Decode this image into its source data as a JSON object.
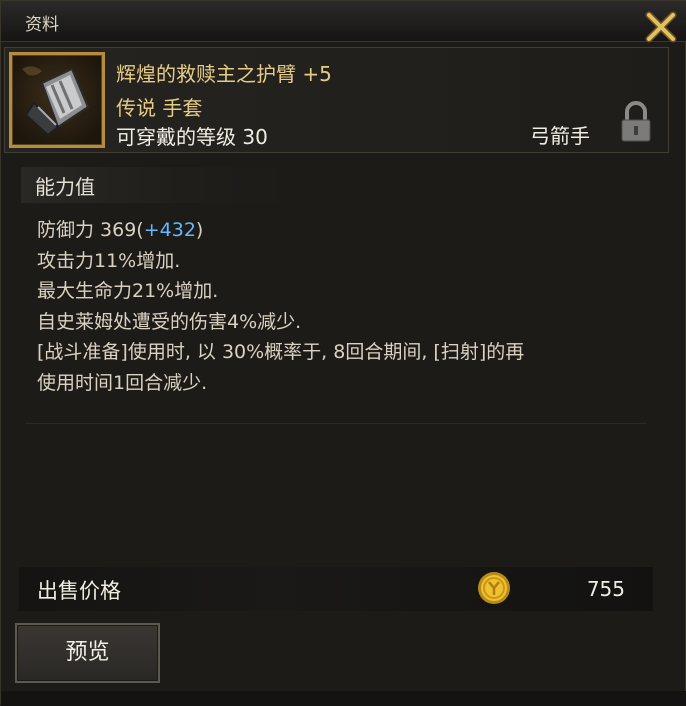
{
  "window": {
    "title": "资料"
  },
  "item": {
    "name": "辉煌的救赎主之护臂 +5",
    "grade_type": "传说 手套",
    "level_req": "可穿戴的等级 30",
    "class": "弓箭手",
    "icon": "bracer-icon",
    "locked": true
  },
  "stats": {
    "title": "能力值",
    "defense_label": "防御力 369(",
    "defense_bonus": "+432",
    "defense_close": ")",
    "lines": [
      "攻击力11%增加.",
      "最大生命力21%增加.",
      "自史莱姆处遭受的伤害4%减少.",
      "[战斗准备]使用时, 以 30%概率于, 8回合期间, [扫射]的再",
      "使用时间1回合减少."
    ]
  },
  "price": {
    "label": "出售价格",
    "value": "755",
    "icon": "gold-coin-icon"
  },
  "buttons": {
    "preview": "预览",
    "close": "close-icon"
  },
  "colors": {
    "item_name": "#e7cc88",
    "bonus": "#65b7ff",
    "frame_gold": "#b68d3c"
  }
}
